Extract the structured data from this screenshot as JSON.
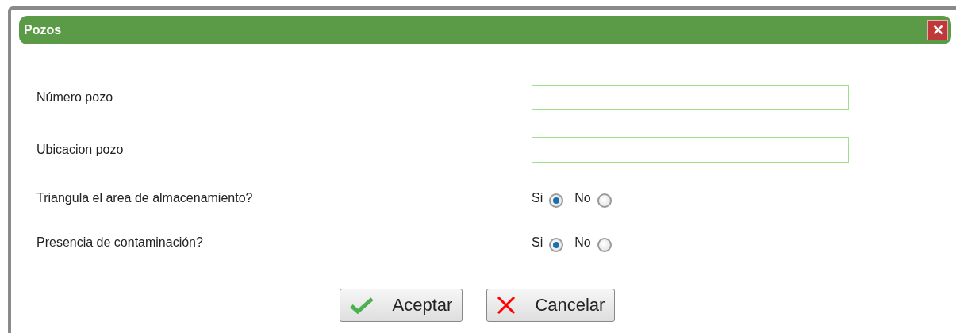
{
  "window": {
    "title": "Pozos",
    "close": "✕"
  },
  "fields": [
    {
      "kind": "text",
      "label": "Número pozo"
    },
    {
      "kind": "text",
      "label": "Ubicacion pozo"
    },
    {
      "kind": "radio",
      "label": "Triangula el area de almacenamiento?",
      "options": [
        {
          "label": "Si",
          "selected": true
        },
        {
          "label": "No",
          "selected": false
        }
      ]
    },
    {
      "kind": "radio",
      "label": "Presencia de contaminación?",
      "options": [
        {
          "label": "Si",
          "selected": true
        },
        {
          "label": "No",
          "selected": false
        }
      ]
    }
  ],
  "buttons": [
    {
      "kind": "accept",
      "label": "Aceptar"
    },
    {
      "kind": "cancel",
      "label": "Cancelar"
    }
  ]
}
